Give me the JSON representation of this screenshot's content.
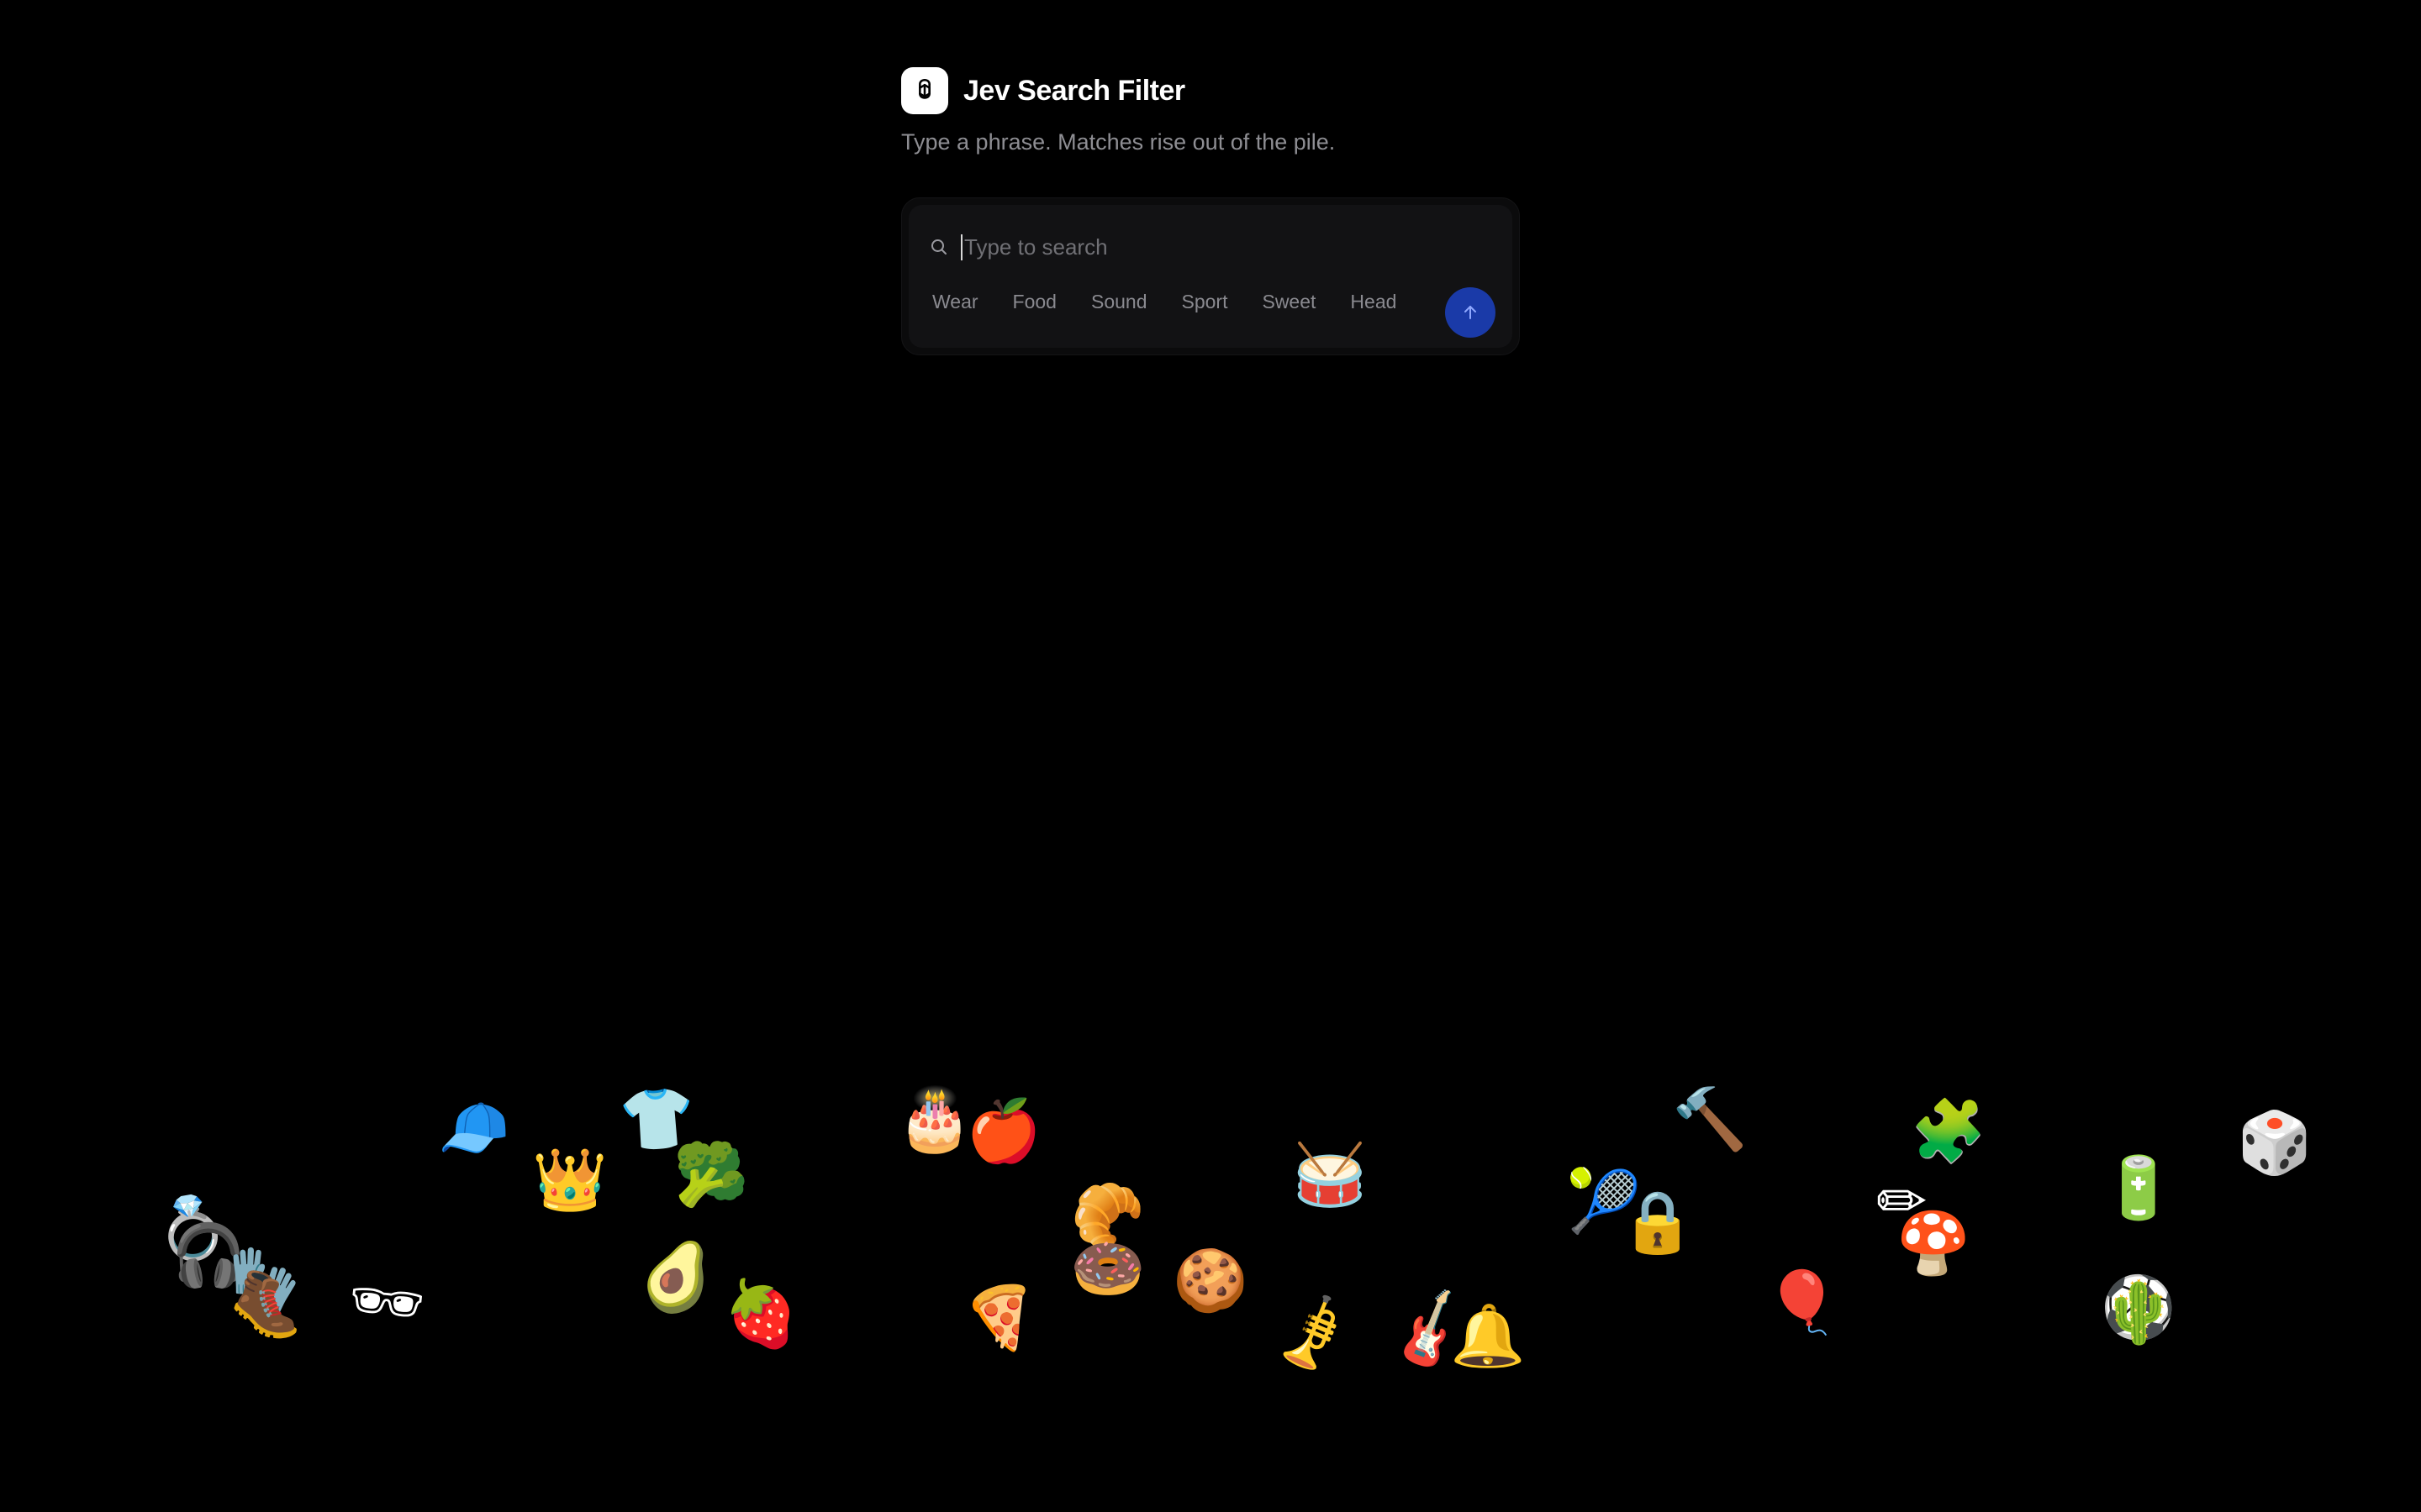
{
  "app": {
    "title": "Jev Search Filter",
    "subtitle": "Type a phrase. Matches rise out of the pile."
  },
  "search": {
    "placeholder": "Type to search",
    "value": ""
  },
  "chips": [
    "Wear",
    "Food",
    "Sound",
    "Sport",
    "Sweet",
    "Head"
  ],
  "submit": {
    "icon": "arrow-up-icon",
    "color": "#1a3aa8"
  },
  "pile": [
    {
      "name": "ring",
      "glyph": "💍"
    },
    {
      "name": "headphones",
      "glyph": "🎧"
    },
    {
      "name": "gloves",
      "glyph": "🧤"
    },
    {
      "name": "boot",
      "glyph": "🥾"
    },
    {
      "name": "sunglasses",
      "glyph": "🕶"
    },
    {
      "name": "cap",
      "glyph": "🧢"
    },
    {
      "name": "crown",
      "glyph": "👑"
    },
    {
      "name": "shirt",
      "glyph": "👕"
    },
    {
      "name": "broccoli",
      "glyph": "🥦"
    },
    {
      "name": "avocado",
      "glyph": "🥑"
    },
    {
      "name": "strawberry",
      "glyph": "🍓"
    },
    {
      "name": "cake",
      "glyph": "🎂"
    },
    {
      "name": "apple",
      "glyph": "🍎"
    },
    {
      "name": "pizza",
      "glyph": "🍕"
    },
    {
      "name": "croissant",
      "glyph": "🥐"
    },
    {
      "name": "donut",
      "glyph": "🍩"
    },
    {
      "name": "cookie",
      "glyph": "🍪"
    },
    {
      "name": "drum",
      "glyph": "🥁"
    },
    {
      "name": "trumpet",
      "glyph": "🎺"
    },
    {
      "name": "guitar",
      "glyph": "🎸"
    },
    {
      "name": "bell",
      "glyph": "🔔"
    },
    {
      "name": "tennis-ball",
      "glyph": "🎾"
    },
    {
      "name": "lock",
      "glyph": "🔒"
    },
    {
      "name": "hammer",
      "glyph": "🔨"
    },
    {
      "name": "balloon",
      "glyph": "🎈"
    },
    {
      "name": "pencil",
      "glyph": "✏"
    },
    {
      "name": "mushroom",
      "glyph": "🍄"
    },
    {
      "name": "puzzle",
      "glyph": "🧩"
    },
    {
      "name": "battery",
      "glyph": "🔋"
    },
    {
      "name": "soccer-ball",
      "glyph": "⚽"
    },
    {
      "name": "cactus",
      "glyph": "🌵"
    },
    {
      "name": "dice",
      "glyph": "🎲"
    }
  ]
}
